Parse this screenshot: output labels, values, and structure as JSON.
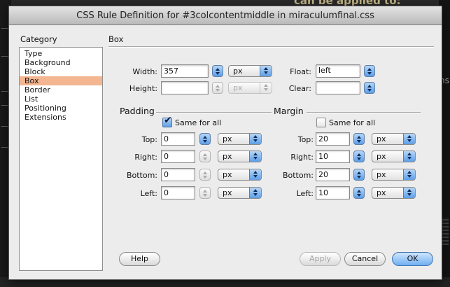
{
  "window": {
    "title": "CSS Rule Definition for #3colcontentmiddle in miraculumfinal.css"
  },
  "background": {
    "heading_fragment": "can be applied to:",
    "side_fragment": "ns"
  },
  "category": {
    "heading": "Category",
    "items": [
      "Type",
      "Background",
      "Block",
      "Box",
      "Border",
      "List",
      "Positioning",
      "Extensions"
    ],
    "selected": "Box"
  },
  "panel": {
    "title": "Box"
  },
  "width": {
    "label": "Width:",
    "value": "357",
    "unit": "px"
  },
  "height": {
    "label": "Height:",
    "value": "",
    "unit": "px"
  },
  "float": {
    "label": "Float:",
    "value": "left"
  },
  "clear": {
    "label": "Clear:",
    "value": ""
  },
  "padding": {
    "title": "Padding",
    "same_for_all_label": "Same for all",
    "same_for_all": true,
    "top": {
      "label": "Top:",
      "value": "0",
      "unit": "px"
    },
    "right": {
      "label": "Right:",
      "value": "0",
      "unit": "px"
    },
    "bottom": {
      "label": "Bottom:",
      "value": "0",
      "unit": "px"
    },
    "left": {
      "label": "Left:",
      "value": "0",
      "unit": "px"
    }
  },
  "margin": {
    "title": "Margin",
    "same_for_all_label": "Same for all",
    "same_for_all": false,
    "top": {
      "label": "Top:",
      "value": "20",
      "unit": "px"
    },
    "right": {
      "label": "Right:",
      "value": "10",
      "unit": "px"
    },
    "bottom": {
      "label": "Bottom:",
      "value": "20",
      "unit": "px"
    },
    "left": {
      "label": "Left:",
      "value": "10",
      "unit": "px"
    }
  },
  "buttons": {
    "help": "Help",
    "apply": "Apply",
    "cancel": "Cancel",
    "ok": "OK"
  },
  "colors": {
    "selection": "#f4b591",
    "accent": "#5d9ee8"
  }
}
